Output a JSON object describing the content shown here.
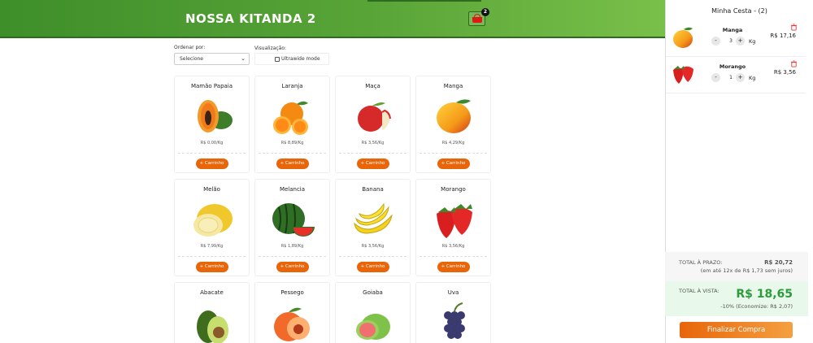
{
  "header": {
    "title": "NOSSA KITANDA 2",
    "cart_count": "2"
  },
  "controls": {
    "order_label": "Ordenar por:",
    "order_selected": "Selecione",
    "view_label": "Visualização:",
    "ultrawide_label": "Ultrawide mode"
  },
  "products": [
    {
      "name": "Mamão Papaia",
      "price": "R$ 0,00/Kg",
      "add": "+ Carrinho",
      "icon": "papaya-icon"
    },
    {
      "name": "Laranja",
      "price": "R$ 8,89/Kg",
      "add": "+ Carrinho",
      "icon": "orange-icon"
    },
    {
      "name": "Maça",
      "price": "R$ 3,56/Kg",
      "add": "+ Carrinho",
      "icon": "apple-icon"
    },
    {
      "name": "Manga",
      "price": "R$ 4,29/Kg",
      "add": "+ Carrinho",
      "icon": "mango-icon"
    },
    {
      "name": "Melão",
      "price": "R$ 7,99/Kg",
      "add": "+ Carrinho",
      "icon": "melon-icon"
    },
    {
      "name": "Melancia",
      "price": "R$ 1,89/Kg",
      "add": "+ Carrinho",
      "icon": "watermelon-icon"
    },
    {
      "name": "Banana",
      "price": "R$ 3,56/Kg",
      "add": "+ Carrinho",
      "icon": "banana-icon"
    },
    {
      "name": "Morango",
      "price": "R$ 3,56/Kg",
      "add": "+ Carrinho",
      "icon": "strawberry-icon"
    },
    {
      "name": "Abacate",
      "icon": "avocado-icon"
    },
    {
      "name": "Pessego",
      "icon": "peach-icon"
    },
    {
      "name": "Goiaba",
      "icon": "guava-icon"
    },
    {
      "name": "Uva",
      "icon": "grapes-icon"
    }
  ],
  "cart": {
    "title": "Minha Cesta - (2)",
    "items": [
      {
        "name": "Manga",
        "qty": "3",
        "unit": "Kg",
        "price": "R$ 17,16",
        "icon": "mango-icon"
      },
      {
        "name": "Morango",
        "qty": "1",
        "unit": "Kg",
        "price": "R$ 3,56",
        "icon": "strawberry-icon"
      }
    ],
    "minus": "-",
    "plus": "+",
    "total_term_label": "TOTAL À PRAZO:",
    "total_term_value": "R$ 20,72",
    "installments": "(em até 12x de R$ 1,73 sem juros)",
    "total_cash_label": "TOTAL À VISTA:",
    "total_cash_value": "R$ 18,65",
    "discount": "-10% (Economize: R$ 2,07)",
    "finish": "Finalizar Compra"
  },
  "colors": {
    "header_green": "#58a437",
    "accent_orange": "#e8650a",
    "price_green": "#2e9a3c"
  }
}
